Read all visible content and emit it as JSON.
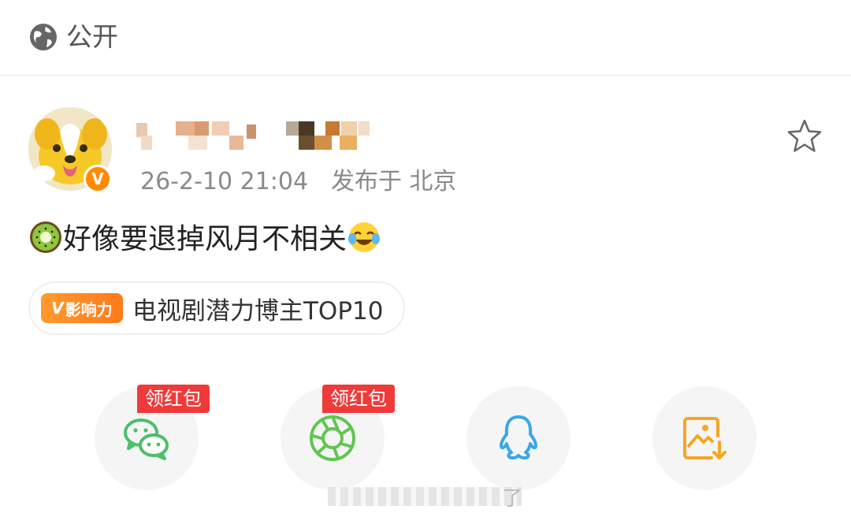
{
  "header": {
    "visibility_label": "公开",
    "icon": "globe-icon"
  },
  "post": {
    "avatar_badge": "V",
    "time": "26-2-10 21:04",
    "location": "发布于 北京",
    "text": "好像要退掉风月不相关",
    "lead_emoji": "kiwi",
    "trail_emoji": "laugh-cry",
    "favorite_icon": "star-outline-icon"
  },
  "influence": {
    "tag_label": "影响力",
    "text": "电视剧潜力博主TOP10"
  },
  "share": [
    {
      "name": "wechat",
      "icon": "wechat-icon",
      "color": "#4cbf6a",
      "badge": "领红包"
    },
    {
      "name": "moments",
      "icon": "moments-icon",
      "color": "#62c552",
      "badge": "领红包"
    },
    {
      "name": "qq",
      "icon": "qq-icon",
      "color": "#3aa6e8",
      "badge": ""
    },
    {
      "name": "save-image",
      "icon": "save-image-icon",
      "color": "#f5a623",
      "badge": ""
    }
  ],
  "bottom_partial_text": "了"
}
